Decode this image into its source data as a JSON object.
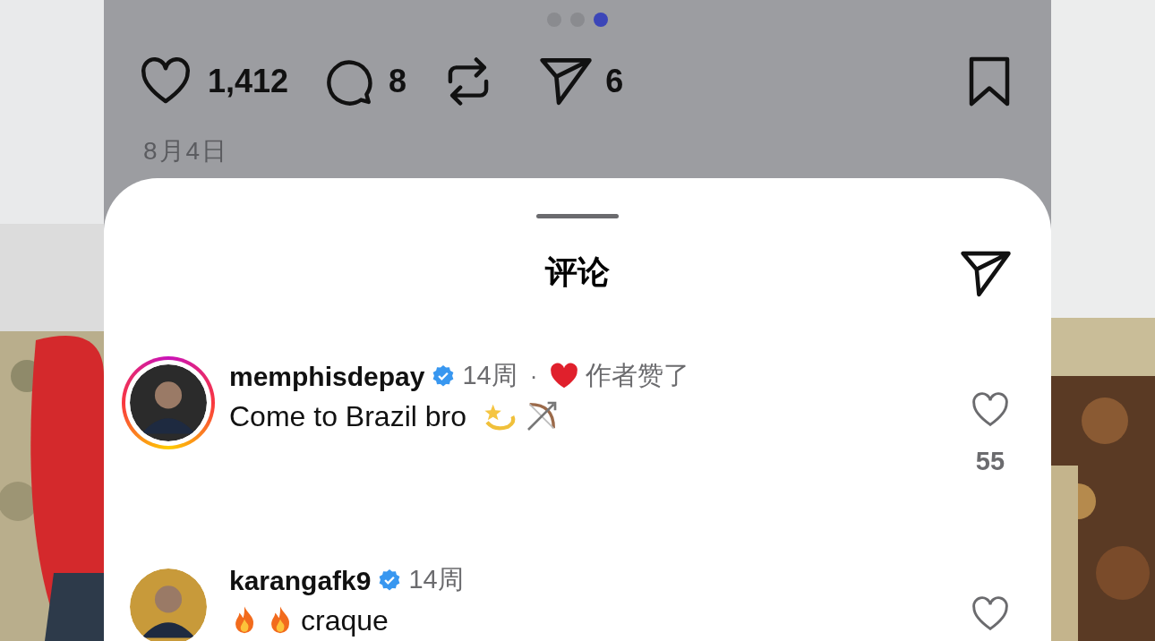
{
  "carousel": {
    "dots": [
      {
        "selected": false
      },
      {
        "selected": false
      },
      {
        "selected": true
      }
    ]
  },
  "actions": {
    "likes": "1,412",
    "comments": "8",
    "shares": "6"
  },
  "date": "8月4日",
  "sheet": {
    "title": "评论",
    "comments": [
      {
        "username": "memphisdepay",
        "verified": true,
        "time": "14周",
        "separator": "·",
        "author_liked": "作者赞了",
        "story_ring": true,
        "text": "Come to Brazil bro",
        "emojis_after": [
          {
            "kind": "sparkle"
          },
          {
            "kind": "bow"
          }
        ],
        "likes": "55"
      },
      {
        "username": "karangafk9",
        "verified": true,
        "time": "14周",
        "story_ring": false,
        "emojis_before": [
          {
            "kind": "fire"
          },
          {
            "kind": "fire"
          }
        ],
        "text": "craque"
      }
    ]
  }
}
